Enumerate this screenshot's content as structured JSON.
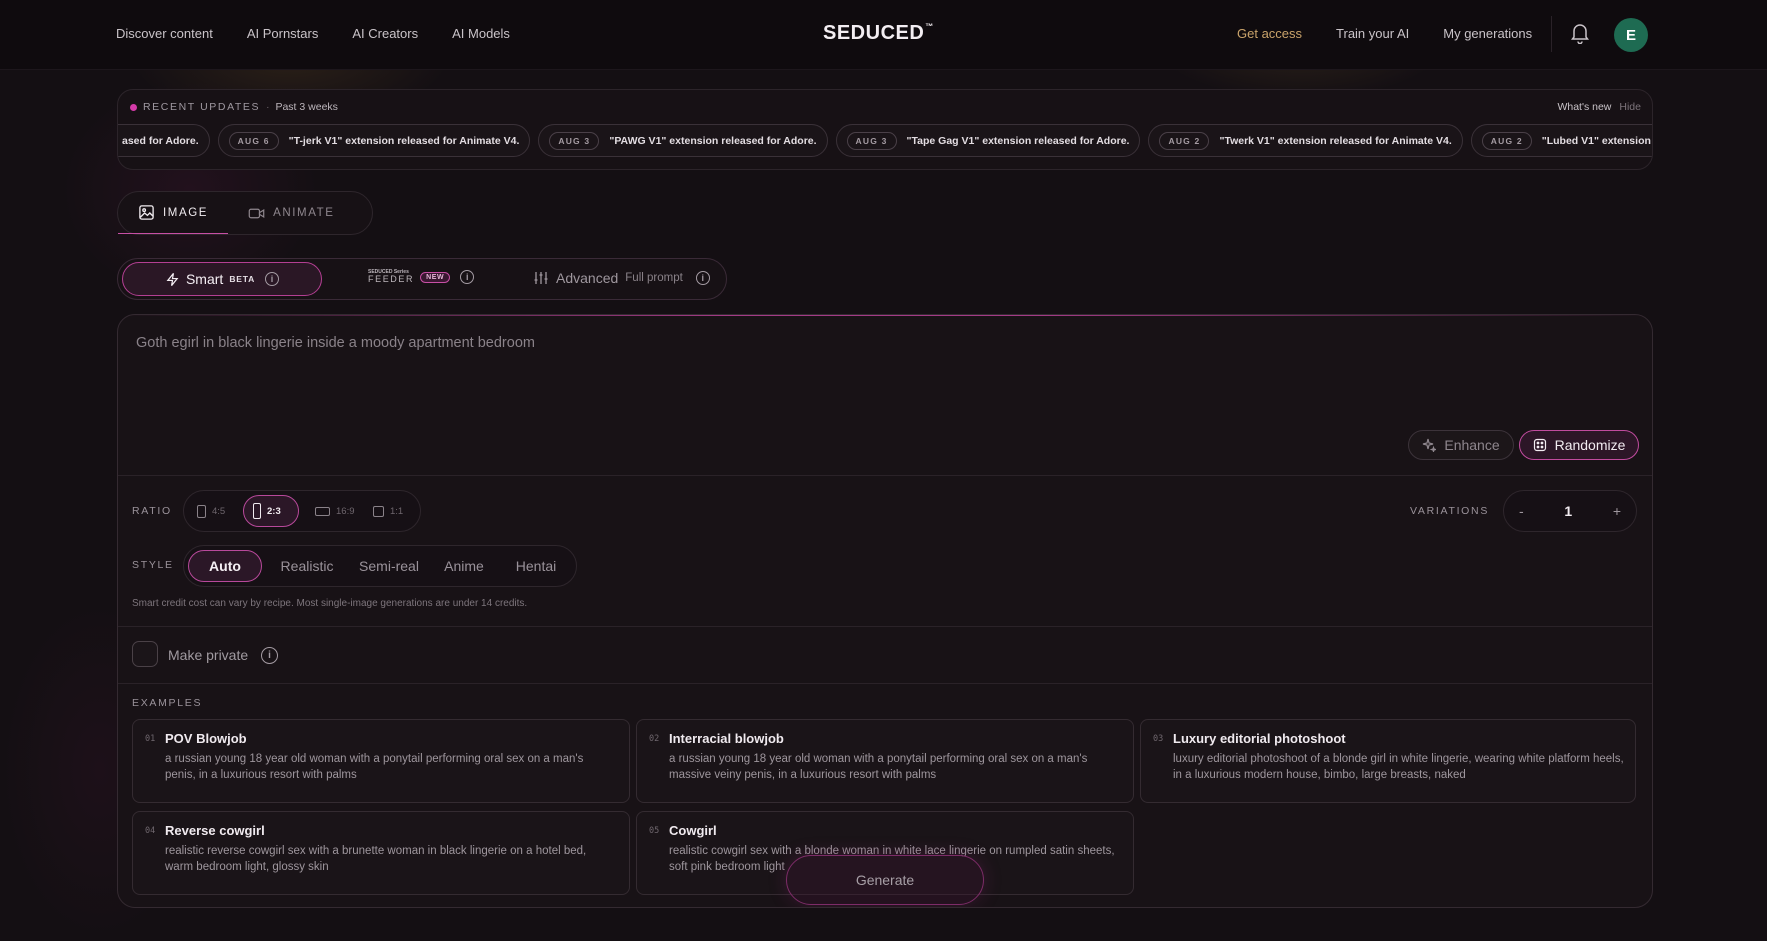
{
  "nav": {
    "left": [
      "Discover content",
      "AI Pornstars",
      "AI Creators",
      "AI Models"
    ],
    "logo": "SEDUCED",
    "logo_mark": "™",
    "right": [
      "Get access",
      "Train your AI",
      "My generations"
    ],
    "avatar_initial": "E"
  },
  "updates": {
    "title": "RECENT UPDATES",
    "sep": "·",
    "subtitle": "Past 3 weeks",
    "whats_new": "What's new",
    "hide": "Hide",
    "lead_fragment": "ased for Adore.",
    "items": [
      {
        "date": "AUG 6",
        "text": "\"T-jerk V1\" extension released for Animate V4."
      },
      {
        "date": "AUG 3",
        "text": "\"PAWG V1\" extension released for Adore."
      },
      {
        "date": "AUG 3",
        "text": "\"Tape Gag V1\" extension released for Adore."
      },
      {
        "date": "AUG 2",
        "text": "\"Twerk V1\" extension released for Animate V4."
      },
      {
        "date": "AUG 2",
        "text": "\"Lubed V1\" extension released for Adore."
      }
    ]
  },
  "mode_tabs": {
    "image": "IMAGE",
    "animate": "ANIMATE"
  },
  "prompt_modes": {
    "smart": "Smart",
    "beta": "BETA",
    "feeder_small": "SEDUCED Series",
    "feeder": "FEEDER",
    "new": "NEW",
    "advanced": "Advanced",
    "full_prompt": "Full prompt"
  },
  "composer": {
    "prompt_placeholder": "Goth egirl in black lingerie inside a moody apartment bedroom",
    "enhance": "Enhance",
    "randomize": "Randomize",
    "ratio_label": "RATIO",
    "ratios": [
      "4:5",
      "2:3",
      "16:9",
      "1:1"
    ],
    "selected_ratio": "2:3",
    "variations_label": "VARIATIONS",
    "variations_minus": "-",
    "variations_value": "1",
    "variations_plus": "+",
    "style_label": "STYLE",
    "styles": [
      "Auto",
      "Realistic",
      "Semi-real",
      "Anime",
      "Hentai"
    ],
    "selected_style": "Auto",
    "credit_note": "Smart credit cost can vary by recipe. Most single-image generations are under 14 credits.",
    "make_private": "Make private",
    "examples_label": "EXAMPLES",
    "generate": "Generate"
  },
  "examples": [
    {
      "num": "01",
      "title": "POV Blowjob",
      "desc": "a russian young 18 year old woman with a ponytail performing oral sex on a man's penis, in a luxurious resort with palms"
    },
    {
      "num": "02",
      "title": "Interracial blowjob",
      "desc": "a russian young 18 year old woman with a ponytail performing oral sex on a man's massive veiny penis, in a luxurious resort with palms"
    },
    {
      "num": "03",
      "title": "Luxury editorial photoshoot",
      "desc": "luxury editorial photoshoot of a blonde girl in white lingerie, wearing white platform heels, in a luxurious modern house, bimbo, large breasts, naked"
    },
    {
      "num": "04",
      "title": "Reverse cowgirl",
      "desc": "realistic reverse cowgirl sex with a brunette woman in black lingerie on a hotel bed, warm bedroom light, glossy skin"
    },
    {
      "num": "05",
      "title": "Cowgirl",
      "desc": "realistic cowgirl sex with a blonde woman in white lace lingerie on rumpled satin sheets, soft pink bedroom light"
    }
  ],
  "colors": {
    "accent": "#c74fa5",
    "gold": "#c9a36a",
    "bg": "#140f13"
  }
}
